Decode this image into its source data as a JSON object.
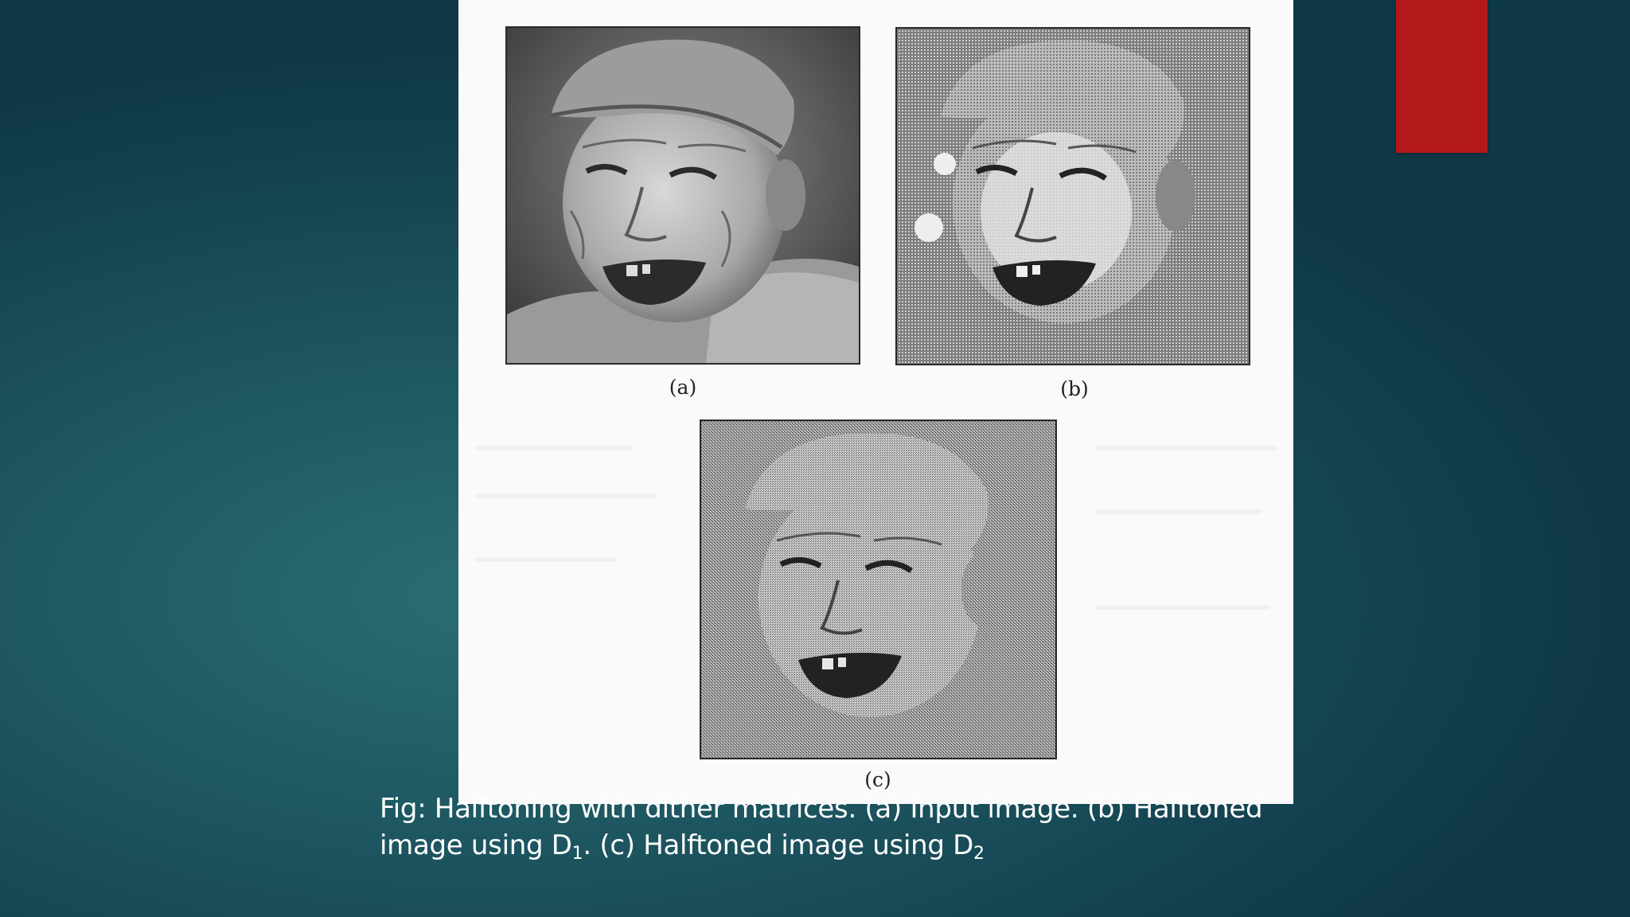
{
  "slide": {
    "accent_color": "#b3191a",
    "background_color": "#1d5660"
  },
  "figure": {
    "label_a": "(a)",
    "label_b": "(b)",
    "label_c": "(c)",
    "image_a_description": "photo-portrait-input",
    "image_b_description": "photo-portrait-halftone-d1",
    "image_c_description": "photo-portrait-halftone-d2"
  },
  "caption": {
    "line1": "Fig: Halftoning with dither matrices. (a) Input image. (b) Halftoned",
    "line2_prefix": "image using D",
    "line2_sub1": "1",
    "line2_middle": ". (c) Halftoned image using D",
    "line2_sub2": "2"
  }
}
